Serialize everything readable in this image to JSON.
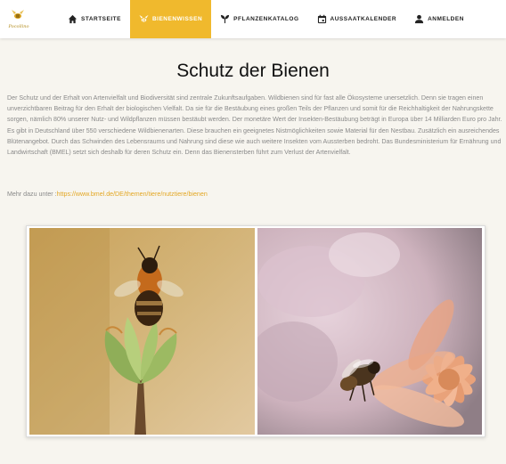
{
  "brand": {
    "logo_text": "Pocollino"
  },
  "nav": [
    {
      "label": "Startseite",
      "icon": "home-icon"
    },
    {
      "label": "Bienenwissen",
      "icon": "bee-icon",
      "active": true
    },
    {
      "label": "Pflanzenkatalog",
      "icon": "plant-icon"
    },
    {
      "label": "Aussaatkalender",
      "icon": "calendar-icon"
    },
    {
      "label": "Anmelden",
      "icon": "user-icon"
    }
  ],
  "page": {
    "title": "Schutz der Bienen",
    "paragraph": "Der Schutz und der Erhalt von Artenvielfalt und Biodiversität sind zentrale Zukunftsaufgaben. Wildbienen sind für fast alle Ökosysteme unersetzlich. Denn sie tragen einen unverzichtbaren Beitrag für den Erhalt der biologischen Vielfalt. Da sie für die Bestäubung eines großen Teils der Pflanzen und somit für die Reichhaltigkeit der Nahrungskette sorgen, nämlich 80% unserer Nutz- und Wildpflanzen müssen bestäubt werden. Der monetäre Wert der Insekten-Bestäubung beträgt in Europa über 14 Milliarden Euro pro Jahr. Es gibt in Deutschland über 550 verschiedene Wildbienenarten. Diese brauchen ein geeignetes Nistmöglichkeiten sowie Material für den Nestbau. Zusätzlich ein ausreichendes Blütenangebot. Durch das Schwinden des Lebensraums und Nahrung sind diese wie auch weitere Insekten vom Aussterben bedroht. Das Bundesministerium für Ernährung und Landwirtschaft (BMEL) setzt sich deshalb für deren Schutz ein. Denn das Bienensterben führt zum Verlust der Artenvielfalt.",
    "more_label": "Mehr dazu unter :",
    "more_link": "https://www.bmel.de/DE/themen/tiere/nutztiere/bienen"
  },
  "colors": {
    "accent": "#f0b92d",
    "link": "#e3a724",
    "background": "#f7f5ef"
  }
}
